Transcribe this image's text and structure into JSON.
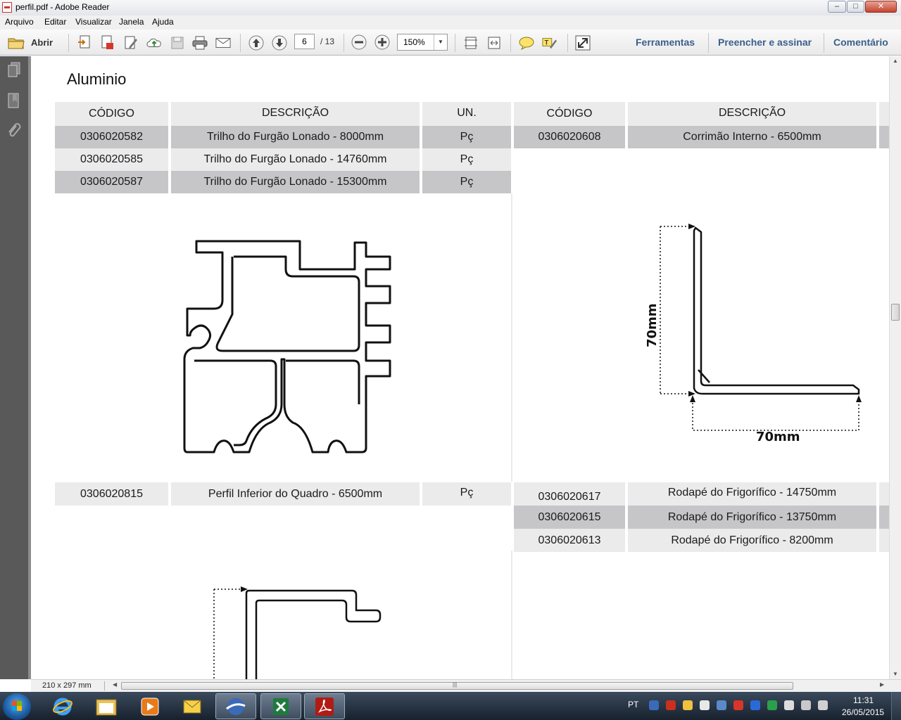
{
  "window": {
    "title": "perfil.pdf - Adobe Reader"
  },
  "menu": [
    "Arquivo",
    "Editar",
    "Visualizar",
    "Janela",
    "Ajuda"
  ],
  "toolbar": {
    "open_label": "Abrir",
    "page_current": "6",
    "page_total": "/ 13",
    "zoom": "150%",
    "panels": [
      "Ferramentas",
      "Preencher e assinar",
      "Comentário"
    ]
  },
  "status": {
    "page_size": "210 x 297 mm"
  },
  "document": {
    "title": "Aluminio",
    "headers": {
      "code": "CÓDIGO",
      "description": "DESCRIÇÃO",
      "unit": "UN."
    },
    "left_table": [
      {
        "code": "0306020582",
        "description": "Trilho do Furgão Lonado - 8000mm",
        "unit": "Pç"
      },
      {
        "code": "0306020585",
        "description": "Trilho do Furgão Lonado - 14760mm",
        "unit": "Pç"
      },
      {
        "code": "0306020587",
        "description": "Trilho do Furgão Lonado - 15300mm",
        "unit": "Pç"
      }
    ],
    "right_table": [
      {
        "code": "0306020608",
        "description": "Corrimão Interno - 6500mm"
      }
    ],
    "left_table_2": [
      {
        "code": "0306020815",
        "description": "Perfil Inferior do Quadro - 6500mm",
        "unit": "Pç"
      }
    ],
    "right_table_2": [
      {
        "code": "0306020617",
        "description": "Rodapé do Frigorífico - 14750mm"
      },
      {
        "code": "0306020615",
        "description": "Rodapé do Frigorífico - 13750mm"
      },
      {
        "code": "0306020613",
        "description": "Rodapé do Frigorífico - 8200mm"
      }
    ],
    "angle_profile": {
      "height_label": "70mm",
      "width_label": "70mm"
    }
  },
  "taskbar": {
    "language": "PT",
    "time": "11:31",
    "date": "26/05/2015",
    "apps": [
      "ie-icon",
      "explorer-icon",
      "media-player-icon",
      "outlook-icon",
      "vpn-icon",
      "excel-icon",
      "adobe-reader-icon"
    ]
  },
  "colors": {
    "row_dark": "#c6c6c8",
    "row_light": "#ebebec",
    "panel_link": "#3a5f8a",
    "nav_pane": "#595959"
  }
}
